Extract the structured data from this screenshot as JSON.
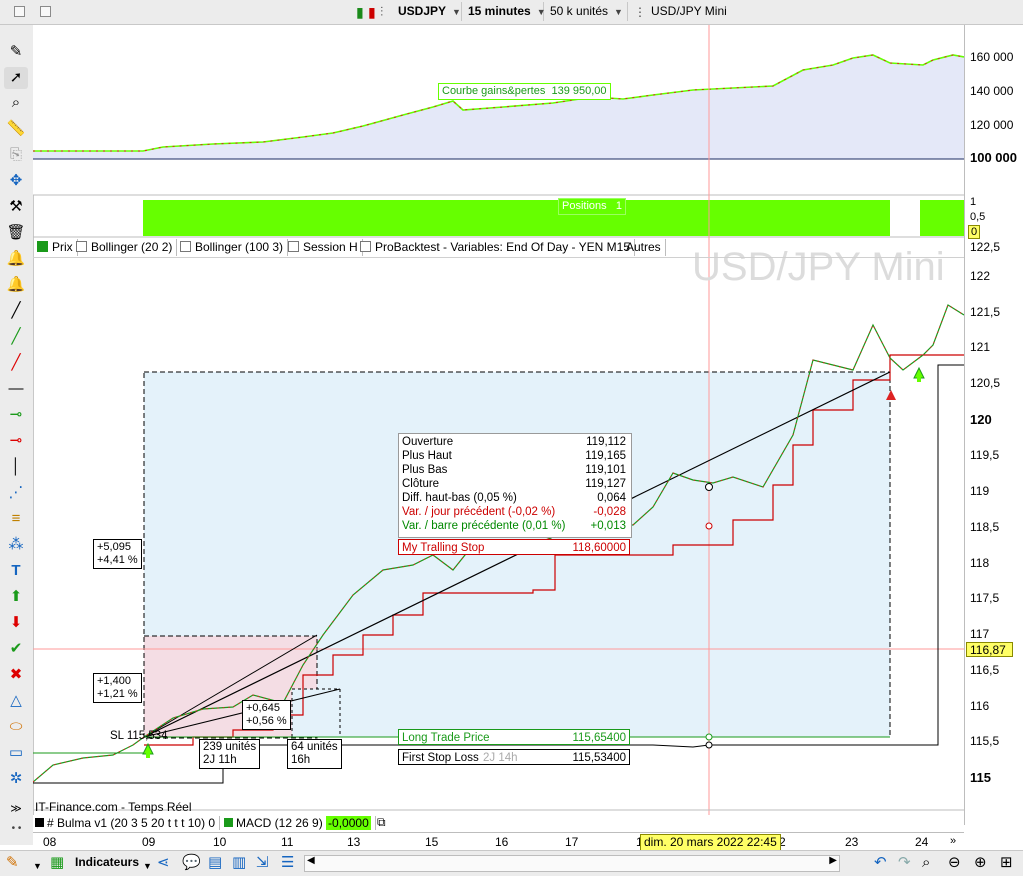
{
  "topbar": {
    "instrument": "USDJPY",
    "timeframe": "15 minutes",
    "units": "50 k unités",
    "chart_title": "USD/JPY Mini"
  },
  "watermark": "USD/JPY Mini",
  "equity_panel": {
    "label": "Courbe gains&pertes",
    "value": "139 950,00",
    "ticks": [
      "160 000",
      "140 000",
      "120 000",
      "100 000"
    ]
  },
  "positions_panel": {
    "label": "Positions",
    "value": "1",
    "ticks": [
      "1",
      "0,5",
      "0"
    ]
  },
  "legend_tabs": [
    {
      "label": "Prix",
      "checked": true
    },
    {
      "label": "Bollinger (20 2)",
      "checked": false
    },
    {
      "label": "Bollinger (100 3)",
      "checked": false
    },
    {
      "label": "Session H",
      "checked": false
    },
    {
      "label": "ProBacktest - Variables: End Of Day - YEN M15",
      "checked": false
    },
    {
      "label": "Autres",
      "checked": false
    }
  ],
  "price_axis": {
    "ticks": [
      "122,5",
      "122",
      "121,5",
      "121",
      "120,5",
      "120",
      "119,5",
      "119",
      "118,5",
      "118",
      "117,5",
      "117",
      "116,5",
      "116",
      "115,5",
      "115"
    ],
    "current_price": "116,87"
  },
  "ohlc_tooltip": {
    "rows": [
      {
        "label": "Ouverture",
        "value": "119,112",
        "color": "#000000"
      },
      {
        "label": "Plus Haut",
        "value": "119,165",
        "color": "#000000"
      },
      {
        "label": "Plus Bas",
        "value": "119,101",
        "color": "#000000"
      },
      {
        "label": "Clôture",
        "value": "119,127",
        "color": "#000000"
      },
      {
        "label": "Diff. haut-bas (0,05 %)",
        "value": "0,064",
        "color": "#000000"
      },
      {
        "label": "Var. / jour précédent (-0,02 %)",
        "value": "-0,028",
        "color": "#cc0000"
      },
      {
        "label": "Var. / barre précédente (0,01 %)",
        "value": "+0,013",
        "color": "#008800"
      }
    ]
  },
  "trade_labels": {
    "trailing_stop": {
      "label": "My Tralling Stop",
      "value": "118,60000"
    },
    "long_trade": {
      "label": "Long Trade Price",
      "value": "115,65400"
    },
    "first_stop": {
      "label": "First Stop Loss",
      "value": "115,53400"
    },
    "ghost_text": "2J 14h",
    "sl_label": "SL 115,534"
  },
  "annotations": {
    "big_gain": [
      "+5,095",
      "+4,41 %"
    ],
    "mid_gain": [
      "+1,400",
      "+1,21 %"
    ],
    "small_gain": [
      "+0,645",
      "+0,56 %"
    ],
    "units1": [
      "239 unités",
      "2J 11h"
    ],
    "units2": [
      "64 unités",
      "16h"
    ]
  },
  "footer_source": "IT-Finance.com - Temps Réel",
  "indicator_tabs": {
    "bulma": "# Bulma v1 (20 3 5 20 t t t 10)  0",
    "macd": "MACD (12 26 9)",
    "macd_value": "-0,0000"
  },
  "x_axis": {
    "ticks": [
      "08",
      "09",
      "10",
      "11",
      "13",
      "15",
      "16",
      "17",
      "1",
      "2",
      "23",
      "24"
    ],
    "cursor_date": "dim. 20 mars 2022 22:45"
  },
  "bottombar": {
    "indicators_label": "Indicateurs"
  },
  "colors": {
    "accent_green": "#66ff00",
    "trailing_red": "#cc0000",
    "highlight_yellow": "#ffff66",
    "equity_fill": "#e4e8f8",
    "trade_fill": "#e4f2fa",
    "loss_fill": "#f4dde4"
  }
}
